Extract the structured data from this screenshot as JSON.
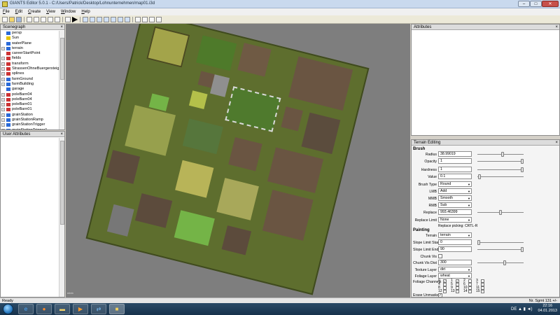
{
  "window": {
    "title": "GIANTS Editor 5.0.1 - C:/Users/Patrick/Desktop/Lohnunternehmen/map01.i3d",
    "min": "–",
    "max": "□",
    "close": "✕"
  },
  "menu": [
    "File",
    "Edit",
    "Create",
    "View",
    "Window",
    "Help"
  ],
  "scenegraph": {
    "title": "Scenegraph",
    "close": "×",
    "items": [
      {
        "label": "persp",
        "icon": "camera-icon",
        "color": "#2a6ad8",
        "exp": "",
        "selected": false
      },
      {
        "label": "Sun",
        "icon": "light-icon",
        "color": "#e6c400",
        "exp": "",
        "selected": false
      },
      {
        "label": "waterPlane",
        "icon": "shape-icon",
        "color": "#2a6ad8",
        "exp": "",
        "selected": false
      },
      {
        "label": "terrain",
        "icon": "terrain-icon",
        "color": "#2a6ad8",
        "exp": "+",
        "selected": false
      },
      {
        "label": "careerStartPoint",
        "icon": "transform-icon",
        "color": "#cc3333",
        "exp": "",
        "selected": false
      },
      {
        "label": "fields",
        "icon": "transform-icon",
        "color": "#cc3333",
        "exp": "+",
        "selected": false
      },
      {
        "label": "transform",
        "icon": "transform-icon",
        "color": "#cc3333",
        "exp": "+",
        "selected": false
      },
      {
        "label": "StrassenOhneBuergersteig",
        "icon": "transform-icon",
        "color": "#cc3333",
        "exp": "+",
        "selected": false
      },
      {
        "label": "splines",
        "icon": "transform-icon",
        "color": "#cc3333",
        "exp": "+",
        "selected": false
      },
      {
        "label": "farmGround",
        "icon": "shape-icon",
        "color": "#2a6ad8",
        "exp": "+",
        "selected": false
      },
      {
        "label": "farmBuilding",
        "icon": "shape-icon",
        "color": "#2a6ad8",
        "exp": "+",
        "selected": false
      },
      {
        "label": "garage",
        "icon": "shape-icon",
        "color": "#2a6ad8",
        "exp": "",
        "selected": false
      },
      {
        "label": "poleBarn04",
        "icon": "transform-icon",
        "color": "#cc3333",
        "exp": "+",
        "selected": false
      },
      {
        "label": "poleBarn04",
        "icon": "transform-icon",
        "color": "#cc3333",
        "exp": "+",
        "selected": false
      },
      {
        "label": "poleBarn01",
        "icon": "transform-icon",
        "color": "#cc3333",
        "exp": "+",
        "selected": false
      },
      {
        "label": "poleBarn01",
        "icon": "transform-icon",
        "color": "#cc3333",
        "exp": "+",
        "selected": false
      },
      {
        "label": "grainStation",
        "icon": "shape-icon",
        "color": "#2a6ad8",
        "exp": "+",
        "selected": false
      },
      {
        "label": "grainStationRamp",
        "icon": "shape-icon",
        "color": "#2a6ad8",
        "exp": "+",
        "selected": false
      },
      {
        "label": "grainStationTrigger",
        "icon": "shape-icon",
        "color": "#2a6ad8",
        "exp": "+",
        "selected": false
      },
      {
        "label": "grainStationTrigger1",
        "icon": "shape-icon",
        "color": "#2a6ad8",
        "exp": "+",
        "selected": false
      }
    ]
  },
  "user_attributes": {
    "title": "User Attributes",
    "close": "×"
  },
  "attributes": {
    "title": "Attributes",
    "close": "×"
  },
  "terrain_editing": {
    "title": "Terrain Editing",
    "close": "×",
    "brush_header": "Brush",
    "radius_label": "Radius",
    "radius_value": "38.99019",
    "opacity_label": "Opacity",
    "opacity_value": "1",
    "hardness_label": "Hardness",
    "hardness_value": "1",
    "value_label": "Value",
    "value_value": "0.1",
    "brush_type_label": "Brush Type",
    "brush_type_value": "Round",
    "lmb_label": "LMB",
    "lmb_value": "Add",
    "mmb_label": "MMB",
    "mmb_value": "Smooth",
    "rmb_label": "RMB",
    "rmb_value": "Sub",
    "replace_label": "Replace",
    "replace_value": "993.46399",
    "replace_limit_label": "Replace Limit",
    "replace_limit_value": "None",
    "replace_picking": "Replace picking: CRTL-R",
    "painting_header": "Painting",
    "terrain_label": "Terrain",
    "terrain_value": "terrain",
    "slope_start_label": "Slope Limit Start",
    "slope_start_value": "0",
    "slope_end_label": "Slope Limit End",
    "slope_end_value": "90",
    "chunk_vis_label": "Chunk Vis",
    "chunk_vis_dist_label": "Chunk Vis Dist",
    "chunk_vis_dist_value": "300",
    "texture_layer_label": "Texture Layer",
    "texture_layer_value": "dirt",
    "foliage_layer_label": "Foliage Layer",
    "foliage_layer_value": "wheat",
    "foliage_channels_label": "Foliage Channels",
    "foliage_channels": [
      "0",
      "1",
      "2",
      "3",
      "4",
      "5",
      "6",
      "7",
      "8",
      "9",
      "10",
      "11",
      "12",
      "13",
      "14",
      "15"
    ],
    "foliage_checked": [
      true,
      true,
      false,
      false,
      false,
      false,
      false,
      false,
      false,
      false,
      false,
      false,
      false,
      false,
      false,
      false
    ],
    "erase_label": "Erase Unmasked",
    "sliders": {
      "radius": 0.55,
      "opacity": 1.0,
      "hardness": 1.0,
      "value": 0.02,
      "replace": 0.5,
      "slope_start": 0.0,
      "slope_end": 1.0,
      "chunk_vis_dist": 0.6
    }
  },
  "status": {
    "left": "Ready",
    "right": "Nr. Sgmt 131 +/-"
  },
  "viewport": {
    "label": "mlnb"
  },
  "taskbar": {
    "apps": [
      "ie-icon",
      "firefox-icon",
      "explorer-icon",
      "media-player-icon",
      "teamviewer-icon",
      "giants-editor-icon"
    ],
    "time": "22:16",
    "date": "04.01.2013",
    "tray": "DE ▲ ▮ ◄)"
  }
}
